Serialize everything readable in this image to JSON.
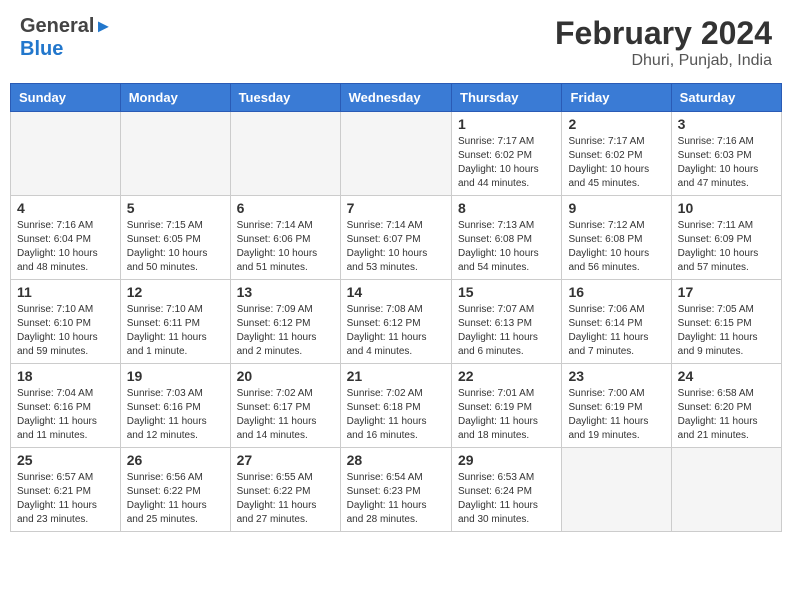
{
  "header": {
    "logo_general": "General",
    "logo_blue": "Blue",
    "month": "February 2024",
    "location": "Dhuri, Punjab, India"
  },
  "weekdays": [
    "Sunday",
    "Monday",
    "Tuesday",
    "Wednesday",
    "Thursday",
    "Friday",
    "Saturday"
  ],
  "weeks": [
    [
      {
        "day": "",
        "info": ""
      },
      {
        "day": "",
        "info": ""
      },
      {
        "day": "",
        "info": ""
      },
      {
        "day": "",
        "info": ""
      },
      {
        "day": "1",
        "info": "Sunrise: 7:17 AM\nSunset: 6:02 PM\nDaylight: 10 hours\nand 44 minutes."
      },
      {
        "day": "2",
        "info": "Sunrise: 7:17 AM\nSunset: 6:02 PM\nDaylight: 10 hours\nand 45 minutes."
      },
      {
        "day": "3",
        "info": "Sunrise: 7:16 AM\nSunset: 6:03 PM\nDaylight: 10 hours\nand 47 minutes."
      }
    ],
    [
      {
        "day": "4",
        "info": "Sunrise: 7:16 AM\nSunset: 6:04 PM\nDaylight: 10 hours\nand 48 minutes."
      },
      {
        "day": "5",
        "info": "Sunrise: 7:15 AM\nSunset: 6:05 PM\nDaylight: 10 hours\nand 50 minutes."
      },
      {
        "day": "6",
        "info": "Sunrise: 7:14 AM\nSunset: 6:06 PM\nDaylight: 10 hours\nand 51 minutes."
      },
      {
        "day": "7",
        "info": "Sunrise: 7:14 AM\nSunset: 6:07 PM\nDaylight: 10 hours\nand 53 minutes."
      },
      {
        "day": "8",
        "info": "Sunrise: 7:13 AM\nSunset: 6:08 PM\nDaylight: 10 hours\nand 54 minutes."
      },
      {
        "day": "9",
        "info": "Sunrise: 7:12 AM\nSunset: 6:08 PM\nDaylight: 10 hours\nand 56 minutes."
      },
      {
        "day": "10",
        "info": "Sunrise: 7:11 AM\nSunset: 6:09 PM\nDaylight: 10 hours\nand 57 minutes."
      }
    ],
    [
      {
        "day": "11",
        "info": "Sunrise: 7:10 AM\nSunset: 6:10 PM\nDaylight: 10 hours\nand 59 minutes."
      },
      {
        "day": "12",
        "info": "Sunrise: 7:10 AM\nSunset: 6:11 PM\nDaylight: 11 hours\nand 1 minute."
      },
      {
        "day": "13",
        "info": "Sunrise: 7:09 AM\nSunset: 6:12 PM\nDaylight: 11 hours\nand 2 minutes."
      },
      {
        "day": "14",
        "info": "Sunrise: 7:08 AM\nSunset: 6:12 PM\nDaylight: 11 hours\nand 4 minutes."
      },
      {
        "day": "15",
        "info": "Sunrise: 7:07 AM\nSunset: 6:13 PM\nDaylight: 11 hours\nand 6 minutes."
      },
      {
        "day": "16",
        "info": "Sunrise: 7:06 AM\nSunset: 6:14 PM\nDaylight: 11 hours\nand 7 minutes."
      },
      {
        "day": "17",
        "info": "Sunrise: 7:05 AM\nSunset: 6:15 PM\nDaylight: 11 hours\nand 9 minutes."
      }
    ],
    [
      {
        "day": "18",
        "info": "Sunrise: 7:04 AM\nSunset: 6:16 PM\nDaylight: 11 hours\nand 11 minutes."
      },
      {
        "day": "19",
        "info": "Sunrise: 7:03 AM\nSunset: 6:16 PM\nDaylight: 11 hours\nand 12 minutes."
      },
      {
        "day": "20",
        "info": "Sunrise: 7:02 AM\nSunset: 6:17 PM\nDaylight: 11 hours\nand 14 minutes."
      },
      {
        "day": "21",
        "info": "Sunrise: 7:02 AM\nSunset: 6:18 PM\nDaylight: 11 hours\nand 16 minutes."
      },
      {
        "day": "22",
        "info": "Sunrise: 7:01 AM\nSunset: 6:19 PM\nDaylight: 11 hours\nand 18 minutes."
      },
      {
        "day": "23",
        "info": "Sunrise: 7:00 AM\nSunset: 6:19 PM\nDaylight: 11 hours\nand 19 minutes."
      },
      {
        "day": "24",
        "info": "Sunrise: 6:58 AM\nSunset: 6:20 PM\nDaylight: 11 hours\nand 21 minutes."
      }
    ],
    [
      {
        "day": "25",
        "info": "Sunrise: 6:57 AM\nSunset: 6:21 PM\nDaylight: 11 hours\nand 23 minutes."
      },
      {
        "day": "26",
        "info": "Sunrise: 6:56 AM\nSunset: 6:22 PM\nDaylight: 11 hours\nand 25 minutes."
      },
      {
        "day": "27",
        "info": "Sunrise: 6:55 AM\nSunset: 6:22 PM\nDaylight: 11 hours\nand 27 minutes."
      },
      {
        "day": "28",
        "info": "Sunrise: 6:54 AM\nSunset: 6:23 PM\nDaylight: 11 hours\nand 28 minutes."
      },
      {
        "day": "29",
        "info": "Sunrise: 6:53 AM\nSunset: 6:24 PM\nDaylight: 11 hours\nand 30 minutes."
      },
      {
        "day": "",
        "info": ""
      },
      {
        "day": "",
        "info": ""
      }
    ]
  ]
}
